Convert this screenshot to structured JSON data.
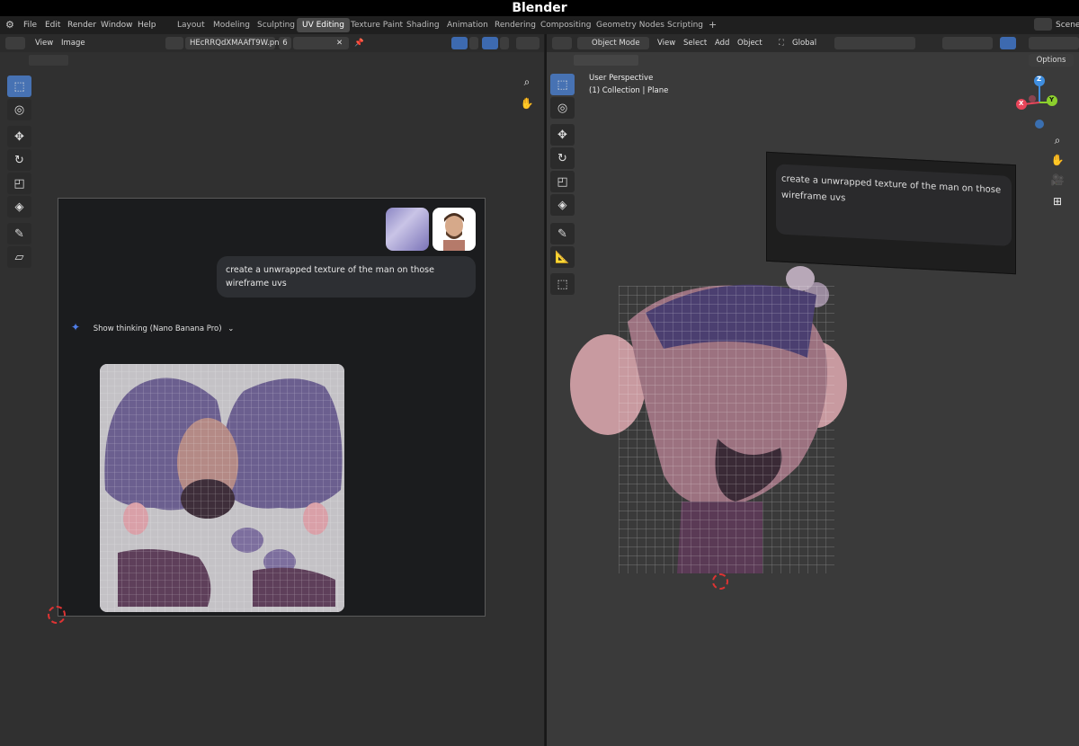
{
  "app": {
    "title": "Blender"
  },
  "menus": [
    "File",
    "Edit",
    "Render",
    "Window",
    "Help"
  ],
  "workspaces": [
    {
      "label": "Layout"
    },
    {
      "label": "Modeling"
    },
    {
      "label": "Sculpting"
    },
    {
      "label": "UV Editing",
      "active": true
    },
    {
      "label": "Texture Paint"
    },
    {
      "label": "Shading"
    },
    {
      "label": "Animation"
    },
    {
      "label": "Rendering"
    },
    {
      "label": "Compositing"
    },
    {
      "label": "Geometry Nodes"
    },
    {
      "label": "Scripting"
    }
  ],
  "add_workspace": "+",
  "scene_label": "Scene",
  "uv_editor": {
    "view": "View",
    "image": "Image",
    "image_name": "HEcRRQdXMAAfT9W.png",
    "users": "6"
  },
  "viewport3d": {
    "mode": "Object Mode",
    "view": "View",
    "select": "Select",
    "add": "Add",
    "object": "Object",
    "orientation": "Global",
    "options": "Options",
    "perspective": "User Perspective",
    "collection": "(1) Collection | Plane",
    "billboard_text": "create a unwrapped texture of the man on those wireframe uvs"
  },
  "chat": {
    "prompt": "create a unwrapped texture of the man on those wireframe uvs",
    "thinking": "Show thinking (Nano Banana Pro)"
  },
  "gizmo": {
    "x": "X",
    "y": "Y",
    "z": "Z",
    "x_color": "#e8455a",
    "y_color": "#8ccf2d",
    "z_color": "#3f8ee0"
  },
  "colors": {
    "accent": "#4772b3",
    "bg": "#303030"
  }
}
